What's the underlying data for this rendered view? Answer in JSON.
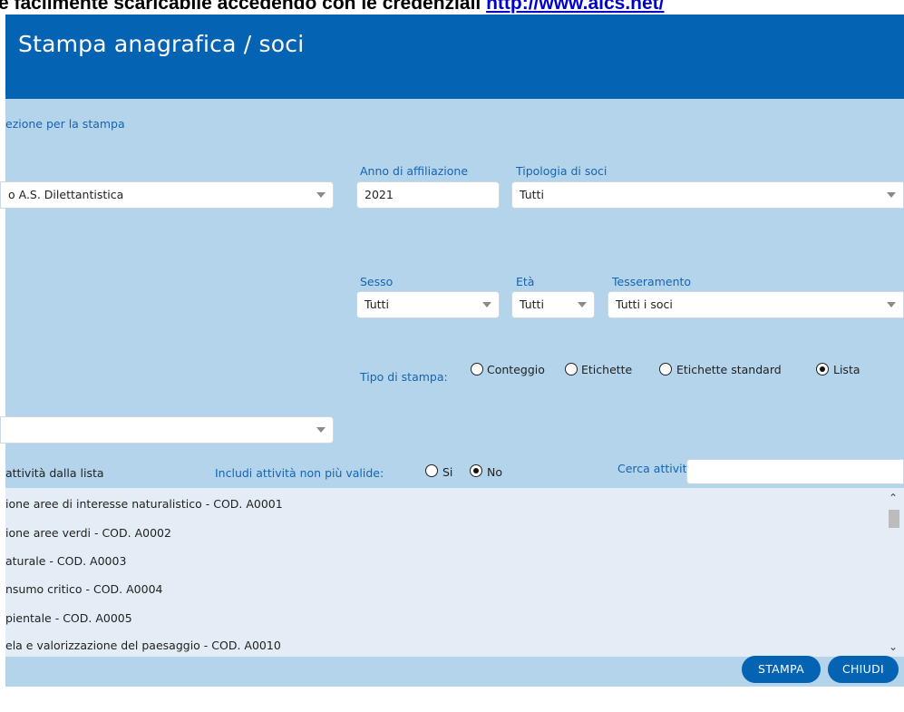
{
  "banner": {
    "text": "e facilmente scaricabile accedendo con le credenziali ",
    "link": "http://www.aics.net/"
  },
  "header": {
    "title": "Stampa anagrafica / soci"
  },
  "section": {
    "title": "ezione per la stampa"
  },
  "ente": {
    "value": "o A.S. Dilettantistica"
  },
  "anno": {
    "label": "Anno di affiliazione",
    "value": "2021"
  },
  "tipologia": {
    "label": "Tipologia di soci",
    "value": "Tutti"
  },
  "sesso": {
    "label": "Sesso",
    "value": "Tutti"
  },
  "eta": {
    "label": "Età",
    "value": "Tutti"
  },
  "tesseramento": {
    "label": "Tesseramento",
    "value": "Tutti i soci"
  },
  "tipo_stampa": {
    "label": "Tipo di stampa:",
    "options": [
      {
        "label": "Conteggio",
        "selected": false
      },
      {
        "label": "Etichette",
        "selected": false
      },
      {
        "label": "Etichette standard",
        "selected": false
      },
      {
        "label": "Lista",
        "selected": true
      }
    ]
  },
  "attivita": {
    "label": "attività dalla lista",
    "includi_label": "Includi attività non più valide:",
    "includi_options": [
      {
        "label": "Si",
        "selected": false
      },
      {
        "label": "No",
        "selected": true
      }
    ],
    "cerca_label": "Cerca attività",
    "cerca_value": "",
    "items": [
      "ione aree di interesse naturalistico - COD. A0001",
      "ione aree verdi - COD. A0002",
      "aturale - COD. A0003",
      "nsumo critico - COD. A0004",
      "pientale - COD. A0005",
      "ela e valorizzazione del paesaggio - COD. A0010"
    ]
  },
  "buttons": {
    "stampa": "STAMPA",
    "chiudi": "CHIUDI"
  }
}
